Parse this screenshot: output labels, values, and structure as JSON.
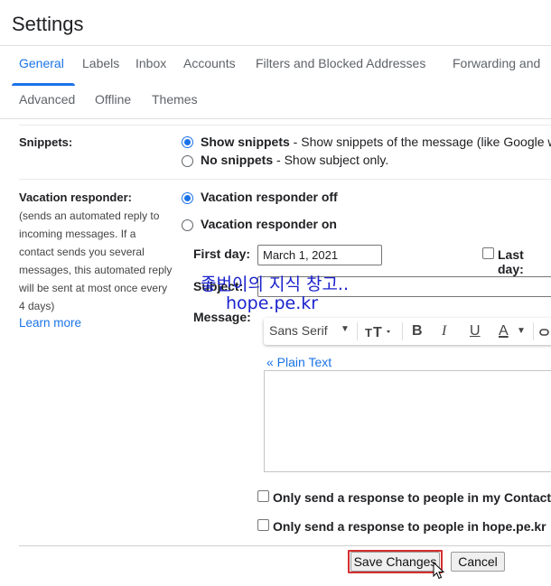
{
  "page": {
    "title": "Settings"
  },
  "tabs": [
    {
      "label": "General",
      "active": true
    },
    {
      "label": "Labels"
    },
    {
      "label": "Inbox"
    },
    {
      "label": "Accounts"
    },
    {
      "label": "Filters and Blocked Addresses"
    },
    {
      "label": "Forwarding and"
    },
    {
      "label": "Advanced"
    },
    {
      "label": "Offline"
    },
    {
      "label": "Themes"
    }
  ],
  "snippets": {
    "label": "Snippets:",
    "show": {
      "bold": "Show snippets",
      "text": " - Show snippets of the message (like Google w",
      "selected": true
    },
    "none": {
      "bold": "No snippets",
      "text": " - Show subject only.",
      "selected": false
    }
  },
  "vacation": {
    "label": "Vacation responder:",
    "description_lines": [
      "(sends an automated reply to",
      "incoming messages. If a",
      "contact sends you several",
      "messages, this automated reply",
      "will be sent at most once every",
      "4 days)"
    ],
    "learn_more": "Learn more",
    "off_label": "Vacation responder off",
    "on_label": "Vacation responder on",
    "off_selected": true,
    "first_day_label": "First day:",
    "first_day_value": "March 1, 2021",
    "last_day_label": "Last day:",
    "subject_label": "Subject:",
    "message_label": "Message:",
    "toolbar": {
      "font": "Sans Serif",
      "size_icon": "text-size-icon",
      "bold": "B",
      "italic": "I",
      "underline": "U",
      "color": "A",
      "link_icon": "link-icon"
    },
    "plain_text": "« Plain Text",
    "contacts_only": "Only send a response to people in my Contacts",
    "domain_only": "Only send a response to people in hope.pe.kr"
  },
  "watermark": {
    "line1": "좋번이의 지식 창고..",
    "line2": "hope.pe.kr"
  },
  "buttons": {
    "save": "Save Changes",
    "cancel": "Cancel"
  },
  "colors": {
    "accent": "#1a73e8",
    "highlight": "#d32f2f",
    "watermark": "#1a22cc"
  }
}
